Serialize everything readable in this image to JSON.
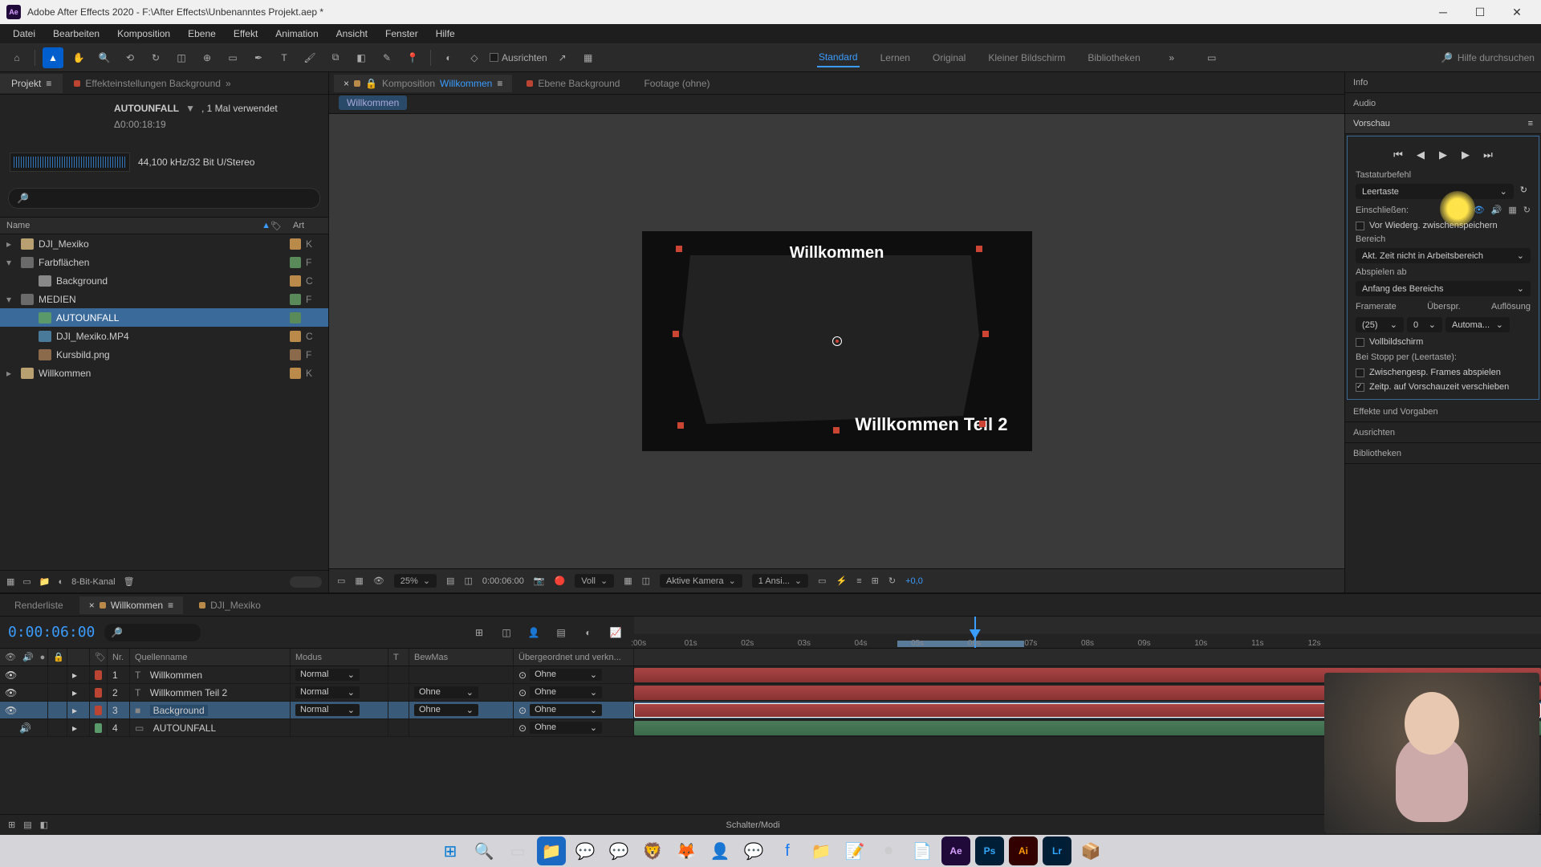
{
  "titlebar": {
    "app_icon_text": "Ae",
    "title": "Adobe After Effects 2020 - F:\\After Effects\\Unbenanntes Projekt.aep *"
  },
  "menubar": [
    "Datei",
    "Bearbeiten",
    "Komposition",
    "Ebene",
    "Effekt",
    "Animation",
    "Ansicht",
    "Fenster",
    "Hilfe"
  ],
  "toolbar": {
    "align_label": "Ausrichten",
    "workspaces": [
      "Standard",
      "Lernen",
      "Original",
      "Kleiner Bildschirm",
      "Bibliotheken"
    ],
    "search_placeholder": "Hilfe durchsuchen"
  },
  "project": {
    "tab_project": "Projekt",
    "tab_effect": "Effekteinstellungen Background",
    "asset_name": "AUTOUNFALL",
    "asset_used": ", 1 Mal verwendet",
    "duration": "Δ0:00:18:19",
    "audio_info": "44,100 kHz/32 Bit U/Stereo",
    "headers": {
      "name": "Name",
      "tag": "",
      "art": "Art"
    },
    "tree": [
      {
        "label": "DJI_Mexiko",
        "type": "comp",
        "art": "K"
      },
      {
        "label": "Farbflächen",
        "type": "folder",
        "art": "F"
      },
      {
        "label": "Background",
        "type": "solid",
        "art": "C",
        "indent": 2
      },
      {
        "label": "MEDIEN",
        "type": "folder",
        "art": "F"
      },
      {
        "label": "AUTOUNFALL",
        "type": "audio",
        "art": "",
        "indent": 2,
        "selected": true
      },
      {
        "label": "DJI_Mexiko.MP4",
        "type": "video",
        "art": "C",
        "indent": 2
      },
      {
        "label": "Kursbild.png",
        "type": "image",
        "art": "F",
        "indent": 2
      },
      {
        "label": "Willkommen",
        "type": "comp",
        "art": "K"
      }
    ],
    "footer_bpc": "8-Bit-Kanal"
  },
  "viewer": {
    "tab_comp_prefix": "Komposition",
    "tab_comp_name": "Willkommen",
    "tab_layer": "Ebene Background",
    "tab_footage": "Footage (ohne)",
    "crumb": "Willkommen",
    "scene_text1": "Willkommen",
    "scene_text2": "Willkommen Teil 2",
    "footer": {
      "zoom": "25%",
      "time": "0:00:06:00",
      "res": "Voll",
      "camera": "Aktive Kamera",
      "views": "1 Ansi...",
      "exposure": "+0,0"
    }
  },
  "right": {
    "info": "Info",
    "audio": "Audio",
    "preview": "Vorschau",
    "shortcut": "Tastaturbefehl",
    "shortcut_value": "Leertaste",
    "include": "Einschließen:",
    "cache_check": "Vor Wiederg. zwischenspeichern",
    "range": "Bereich",
    "range_value": "Akt. Zeit nicht in Arbeitsbereich",
    "play_from": "Abspielen ab",
    "play_from_value": "Anfang des Bereichs",
    "framerate": "Framerate",
    "skip": "Überspr.",
    "resolution": "Auflösung",
    "framerate_value": "(25)",
    "skip_value": "0",
    "resolution_value": "Automa...",
    "fullscreen": "Vollbildschirm",
    "stop_label": "Bei Stopp per (Leertaste):",
    "cached_frames": "Zwischengesp. Frames abspielen",
    "move_time": "Zeitp. auf Vorschauzeit verschieben",
    "effects": "Effekte und Vorgaben",
    "align": "Ausrichten",
    "libraries": "Bibliotheken"
  },
  "timeline": {
    "tab_render": "Renderliste",
    "tab_comp1": "Willkommen",
    "tab_comp2": "DJI_Mexiko",
    "current_time": "0:00:06:00",
    "cols": {
      "nr": "Nr.",
      "source": "Quellenname",
      "mode": "Modus",
      "t": "T",
      "trk": "BewMas",
      "parent": "Übergeordnet und verkn..."
    },
    "mode_normal": "Normal",
    "trk_none": "Ohne",
    "parent_none": "Ohne",
    "layers": [
      {
        "num": "1",
        "name": "Willkommen",
        "type": "T",
        "color": "red",
        "mode": true,
        "trk": false
      },
      {
        "num": "2",
        "name": "Willkommen Teil 2",
        "type": "T",
        "color": "red",
        "mode": true,
        "trk": true
      },
      {
        "num": "3",
        "name": "Background",
        "type": "S",
        "color": "red",
        "mode": true,
        "trk": true,
        "selected": true
      },
      {
        "num": "4",
        "name": "AUTOUNFALL",
        "type": "A",
        "color": "audio",
        "mode": false,
        "trk": false
      }
    ],
    "ticks": [
      ":00s",
      "01s",
      "02s",
      "03s",
      "04s",
      "05s",
      "06s",
      "07s",
      "08s",
      "09s",
      "10s",
      "11s",
      "12s"
    ],
    "footer_label": "Schalter/Modi"
  }
}
